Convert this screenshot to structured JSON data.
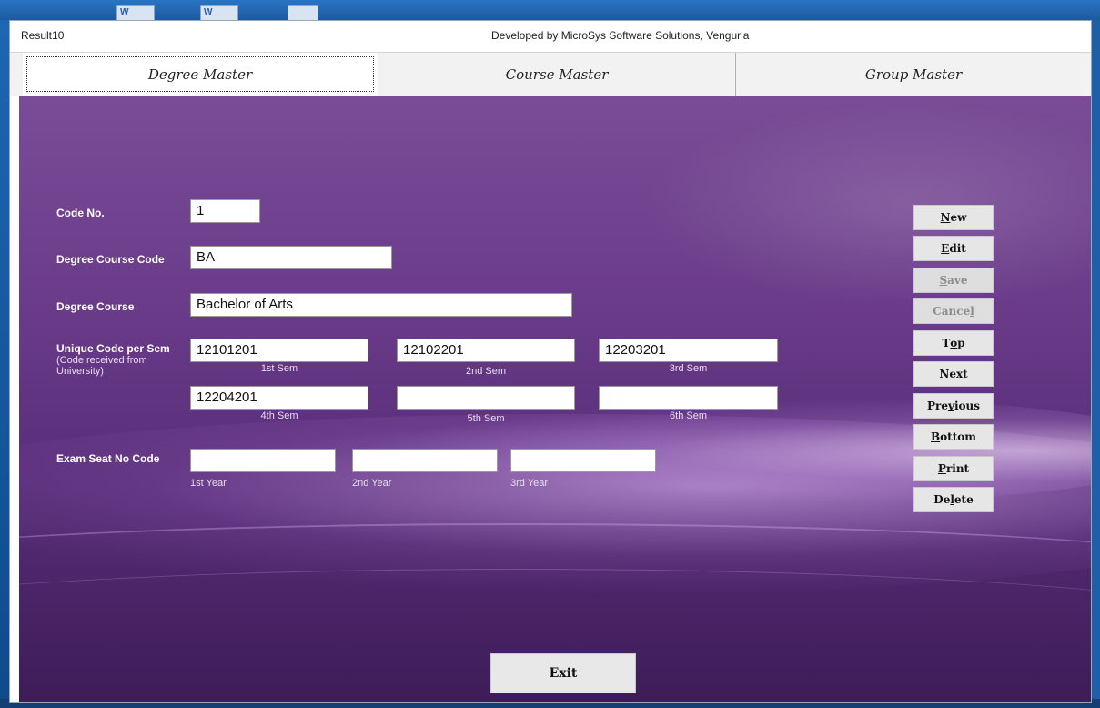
{
  "window": {
    "app_title": "Result10",
    "developer": "Developed by MicroSys Software Solutions, Vengurla"
  },
  "tabs": [
    {
      "label": "Degree Master",
      "active": true
    },
    {
      "label": "Course Master",
      "active": false
    },
    {
      "label": "Group Master",
      "active": false
    }
  ],
  "form": {
    "code_no": {
      "label": "Code No.",
      "value": "1"
    },
    "degree_course_code": {
      "label": "Degree Course Code",
      "value": "BA"
    },
    "degree_course": {
      "label": "Degree Course",
      "value": "Bachelor of Arts"
    },
    "unique_code": {
      "label": "Unique Code per Sem",
      "sublabel_1": "(Code received from",
      "sublabel_2": "University)",
      "sems": [
        {
          "caption": "1st Sem",
          "value": "12101201"
        },
        {
          "caption": "2nd Sem",
          "value": "12102201"
        },
        {
          "caption": "3rd Sem",
          "value": "12203201"
        },
        {
          "caption": "4th Sem",
          "value": "12204201"
        },
        {
          "caption": "5th Sem",
          "value": ""
        },
        {
          "caption": "6th Sem",
          "value": ""
        }
      ]
    },
    "exam_seat": {
      "label": "Exam Seat No Code",
      "years": [
        {
          "caption": "1st Year",
          "value": ""
        },
        {
          "caption": "2nd Year",
          "value": ""
        },
        {
          "caption": "3rd Year",
          "value": ""
        }
      ]
    }
  },
  "buttons": {
    "new": {
      "pre": "",
      "u": "N",
      "post": "ew",
      "enabled": true
    },
    "edit": {
      "pre": "",
      "u": "E",
      "post": "dit",
      "enabled": true
    },
    "save": {
      "pre": "",
      "u": "S",
      "post": "ave",
      "enabled": false
    },
    "cancel": {
      "pre": "Cance",
      "u": "l",
      "post": "",
      "enabled": false
    },
    "top": {
      "pre": "T",
      "u": "o",
      "post": "p",
      "enabled": true
    },
    "next": {
      "pre": "Nex",
      "u": "t",
      "post": "",
      "enabled": true
    },
    "previous": {
      "pre": "Pre",
      "u": "v",
      "post": "ious",
      "enabled": true
    },
    "bottom": {
      "pre": "",
      "u": "B",
      "post": "ottom",
      "enabled": true
    },
    "print": {
      "pre": "",
      "u": "P",
      "post": "rint",
      "enabled": true
    },
    "delete": {
      "pre": "De",
      "u": "l",
      "post": "ete",
      "enabled": true
    }
  },
  "exit_label": "Exit",
  "colors": {
    "panel_top": "#7a4c97",
    "panel_bottom": "#3d1c58",
    "button_bg": "#e6e6e6",
    "disabled_text": "#8d8d8d"
  }
}
